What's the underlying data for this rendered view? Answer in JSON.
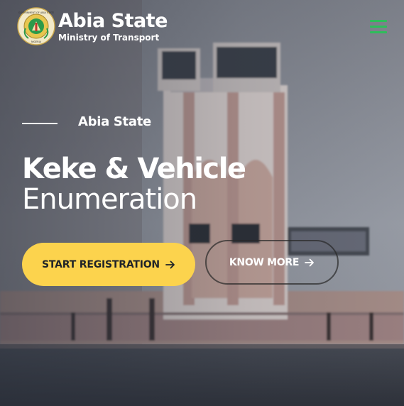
{
  "header": {
    "brand_title": "Abia State",
    "brand_subtitle": "Ministry of Transport",
    "emblem_icon": "abia-state-seal",
    "emblem_text_top": "GOVERNMENT OF ABIA STATE",
    "emblem_text_bottom": "NIGERIA",
    "menu_icon": "hamburger-icon",
    "menu_color": "#2ebd5a"
  },
  "hero": {
    "eyebrow": "Abia State",
    "title_line1": "Keke & Vehicle",
    "title_line2": "Enumeration",
    "primary_button": "START REGISTRATION",
    "secondary_button": "KNOW MORE",
    "button_icon": "arrow-right-icon",
    "primary_color": "#fcd34d"
  }
}
